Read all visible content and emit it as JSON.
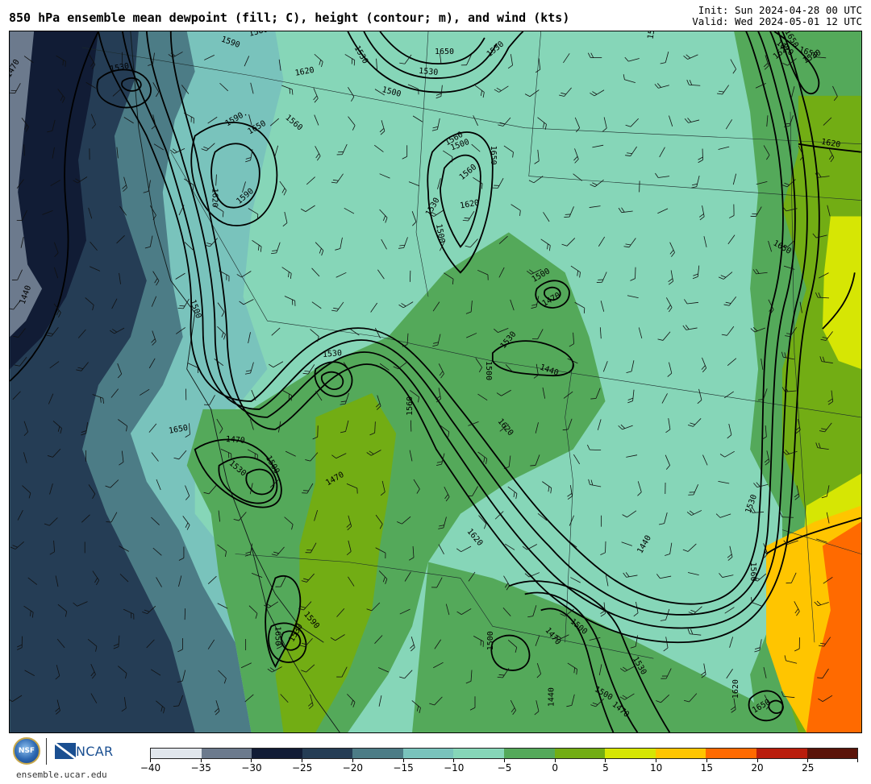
{
  "header": {
    "title": "850 hPa ensemble mean dewpoint (fill; C), height (contour; m), and wind (kts)",
    "init": "Init: Sun 2024-04-28 00 UTC",
    "valid": "Valid: Wed 2024-05-01 12 UTC"
  },
  "footer": {
    "nsf_logo_text": "NSF",
    "ncar_logo_text": "NCAR",
    "site": "ensemble.ucar.edu"
  },
  "colorbar": {
    "tick_labels": [
      "−40",
      "−35",
      "−30",
      "−25",
      "−20",
      "−15",
      "−10",
      "−5",
      "0",
      "5",
      "10",
      "15",
      "20",
      "25"
    ],
    "colors": [
      "#e1e6ec",
      "#6c7a8d",
      "#111c35",
      "#253d55",
      "#4c7c86",
      "#79c3bc",
      "#86d6b8",
      "#54a95a",
      "#72ad14",
      "#d6e604",
      "#ffc500",
      "#ff6a00",
      "#b91d0c",
      "#5a1409"
    ]
  },
  "map": {
    "contour_labels": [
      "1590",
      "1560",
      "1530",
      "1620",
      "1650",
      "1500",
      "1530",
      "1470",
      "1440",
      "1530",
      "1590.",
      "1650",
      "1560",
      "1620",
      "1590",
      "1560",
      "1500",
      "1650",
      "1560",
      "1500",
      "1530",
      "1620",
      "1530",
      "1590",
      "1650",
      "1620",
      "1650",
      "1620",
      "1530",
      "1650",
      "1620",
      "1500",
      "1470",
      "1530",
      "1500",
      "1440",
      "1620",
      "1650",
      "1470",
      "1500",
      "1530",
      "1470",
      "1560",
      "1530",
      "1620",
      "1590",
      "1650",
      "1530",
      "1500",
      "1470",
      "1500",
      "1530",
      "1500",
      "1470",
      "1440",
      "1530",
      "1560",
      "1620",
      "1650",
      "1440",
      "1500"
    ]
  }
}
